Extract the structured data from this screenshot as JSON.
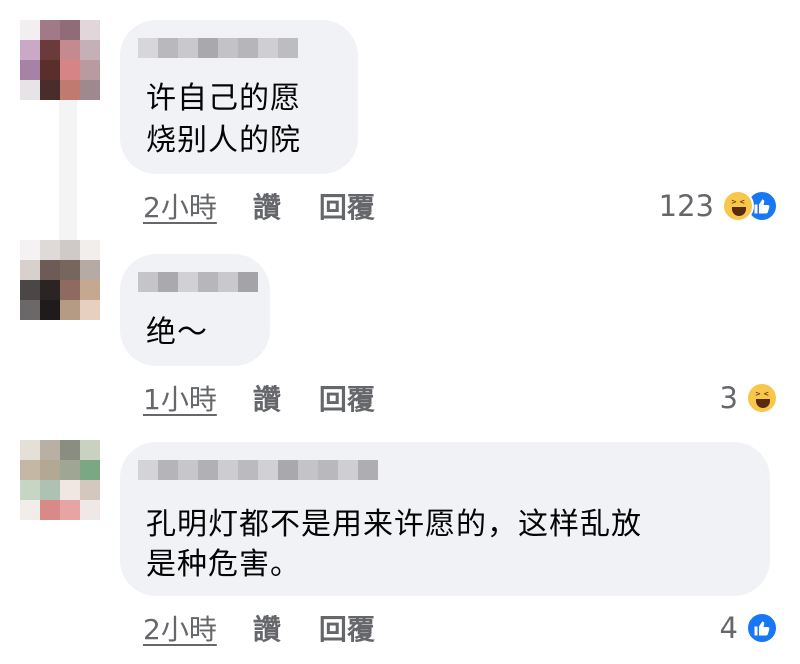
{
  "colors": {
    "bubble": "#f0f2f5",
    "meta_text": "#65676b",
    "like_blue": "#1877f2",
    "haha_yellow": "#f7c64a"
  },
  "comments": [
    {
      "author": "",
      "text_lines": [
        "许自己的愿",
        "烧别人的院"
      ],
      "time": "2小時",
      "like_label": "讚",
      "reply_label": "回覆",
      "reaction_count": "123",
      "reactions": [
        "haha-icon",
        "like-icon"
      ]
    },
    {
      "author": "",
      "text_lines": [
        "绝～"
      ],
      "time": "1小時",
      "like_label": "讚",
      "reply_label": "回覆",
      "reaction_count": "3",
      "reactions": [
        "haha-icon"
      ]
    },
    {
      "author": "",
      "text_lines": [
        "孔明灯都不是用来许愿的，这样乱放",
        "是种危害。"
      ],
      "time": "2小時",
      "like_label": "讚",
      "reply_label": "回覆",
      "reaction_count": "4",
      "reactions": [
        "like-icon"
      ]
    }
  ]
}
